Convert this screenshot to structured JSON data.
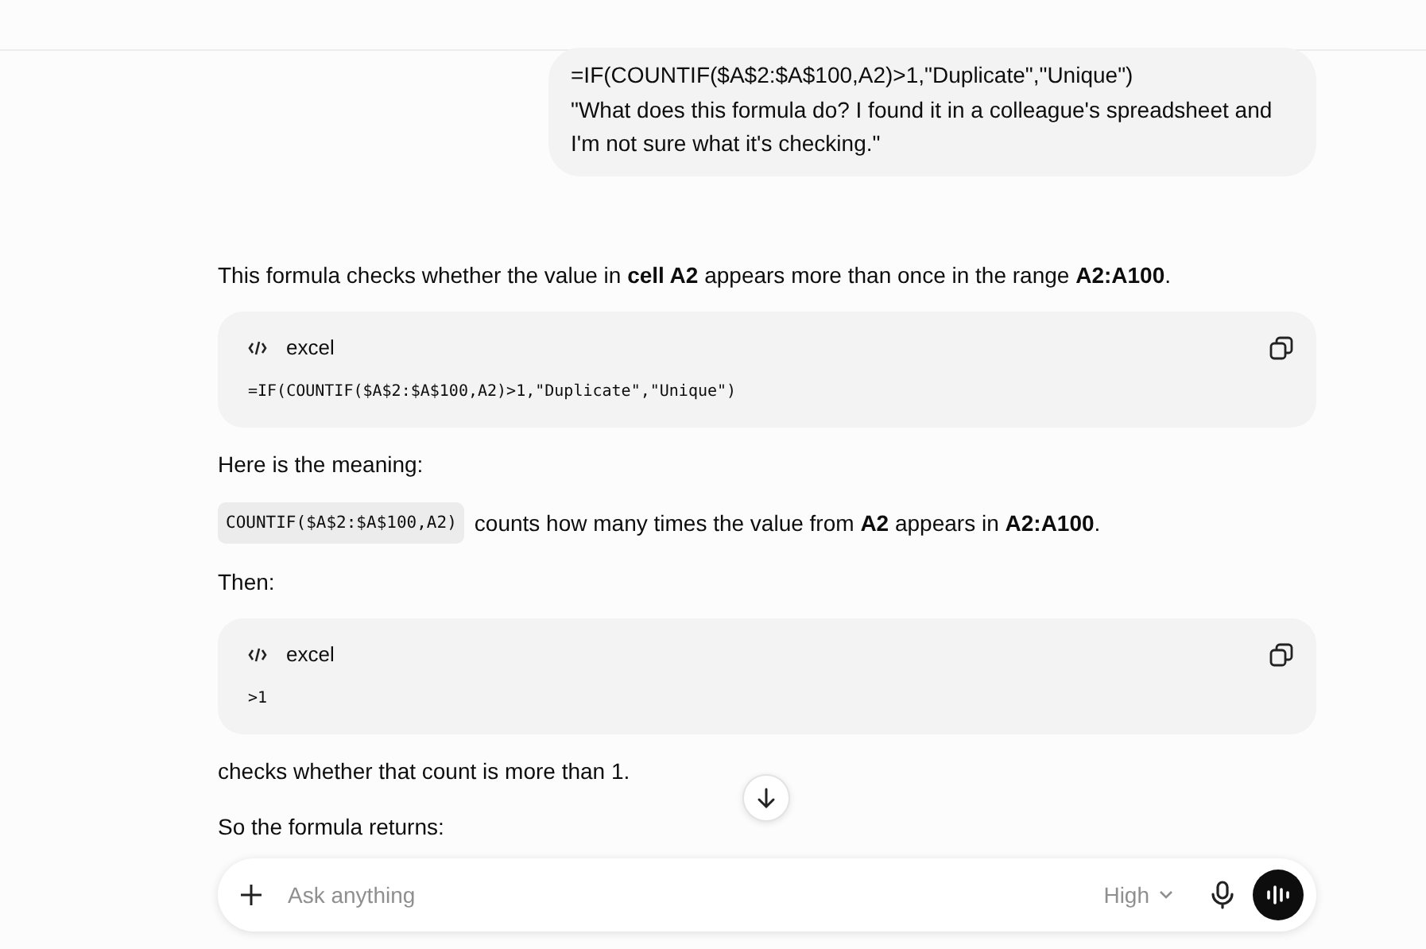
{
  "user_message": {
    "text": "=IF(COUNTIF($A$2:$A$100,A2)>1,\"Duplicate\",\"Unique\")\n\"What does this formula do? I found it in a colleague's spreadsheet and I'm not sure what it's checking.\""
  },
  "response": [
    {
      "kind": "paragraph",
      "text": "This formula checks whether the value in **cell A2** appears more than once in the range **A2:A100**."
    },
    {
      "kind": "code",
      "language": "excel",
      "code": "=IF(COUNTIF($A$2:$A$100,A2)>1,\"Duplicate\",\"Unique\")"
    },
    {
      "kind": "paragraph",
      "text": "Here is the meaning:"
    },
    {
      "kind": "inline_code",
      "code": "COUNTIF($A$2:$A$100,A2)",
      "text": "counts how many times the value from **A2** appears in **A2:A100**."
    },
    {
      "kind": "paragraph",
      "text": "Then:"
    },
    {
      "kind": "code",
      "language": "excel",
      "code": ">1"
    },
    {
      "kind": "paragraph",
      "text": "checks whether that count is more than 1."
    },
    {
      "kind": "paragraph",
      "text": "So the formula returns:"
    }
  ],
  "composer": {
    "placeholder": "Ask anything",
    "model": "High"
  }
}
